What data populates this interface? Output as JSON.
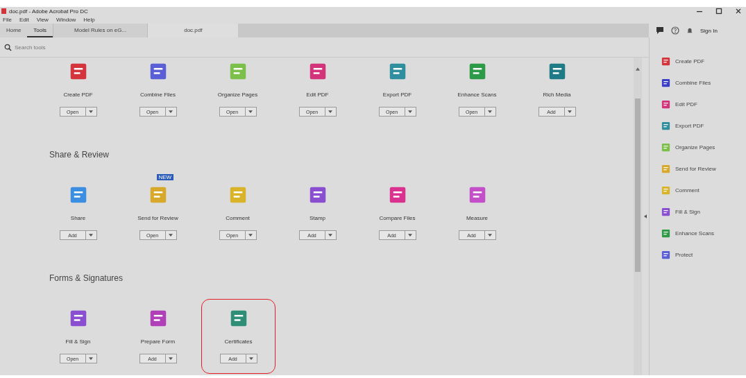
{
  "window": {
    "title": "doc.pdf - Adobe Acrobat Pro DC",
    "menu": [
      "File",
      "Edit",
      "View",
      "Window",
      "Help"
    ]
  },
  "tabs": [
    {
      "label": "Home",
      "selected": false
    },
    {
      "label": "Tools",
      "selected": true
    },
    {
      "label": "Model Rules on eG...",
      "selected": false
    },
    {
      "label": "doc.pdf",
      "selected": false
    }
  ],
  "account": {
    "sign_in": "Sign In"
  },
  "search": {
    "placeholder": "Search tools"
  },
  "sections": [
    {
      "tools": [
        {
          "name": "Create PDF",
          "button": "Open",
          "color": "#d4343c"
        },
        {
          "name": "Combine Files",
          "button": "Open",
          "color": "#5b5fd6"
        },
        {
          "name": "Organize Pages",
          "button": "Open",
          "color": "#7cbf4a"
        },
        {
          "name": "Edit PDF",
          "button": "Open",
          "color": "#d2337a"
        },
        {
          "name": "Export PDF",
          "button": "Open",
          "color": "#2f8f9f"
        },
        {
          "name": "Enhance Scans",
          "button": "Open",
          "color": "#2d9a47"
        },
        {
          "name": "Rich Media",
          "button": "Add",
          "color": "#1f7b85"
        }
      ]
    },
    {
      "title": "Share & Review",
      "tools": [
        {
          "name": "Share",
          "button": "Add",
          "color": "#3b8ee0"
        },
        {
          "name": "Send for Review",
          "button": "Open",
          "color": "#d8a82a",
          "badge": "NEW"
        },
        {
          "name": "Comment",
          "button": "Open",
          "color": "#d9b42a"
        },
        {
          "name": "Stamp",
          "button": "Add",
          "color": "#8a4fd0"
        },
        {
          "name": "Compare Files",
          "button": "Add",
          "color": "#d9338f"
        },
        {
          "name": "Measure",
          "button": "Add",
          "color": "#c34fc9"
        }
      ]
    },
    {
      "title": "Forms & Signatures",
      "tools": [
        {
          "name": "Fill & Sign",
          "button": "Open",
          "color": "#8a4fd0"
        },
        {
          "name": "Prepare Form",
          "button": "Add",
          "color": "#b03fb8"
        },
        {
          "name": "Certificates",
          "button": "Add",
          "color": "#2f8f76",
          "highlighted": true
        }
      ]
    }
  ],
  "sidebar": {
    "items": [
      {
        "name": "Create PDF",
        "color": "#d4343c"
      },
      {
        "name": "Combine Files",
        "color": "#3a3fc6"
      },
      {
        "name": "Edit PDF",
        "color": "#d2337a"
      },
      {
        "name": "Export PDF",
        "color": "#2f8f9f"
      },
      {
        "name": "Organize Pages",
        "color": "#7cbf4a"
      },
      {
        "name": "Send for Review",
        "color": "#d8a82a"
      },
      {
        "name": "Comment",
        "color": "#d9b42a"
      },
      {
        "name": "Fill & Sign",
        "color": "#8a4fd0"
      },
      {
        "name": "Enhance Scans",
        "color": "#2d9a47"
      },
      {
        "name": "Protect",
        "color": "#5b5fd6"
      }
    ]
  }
}
